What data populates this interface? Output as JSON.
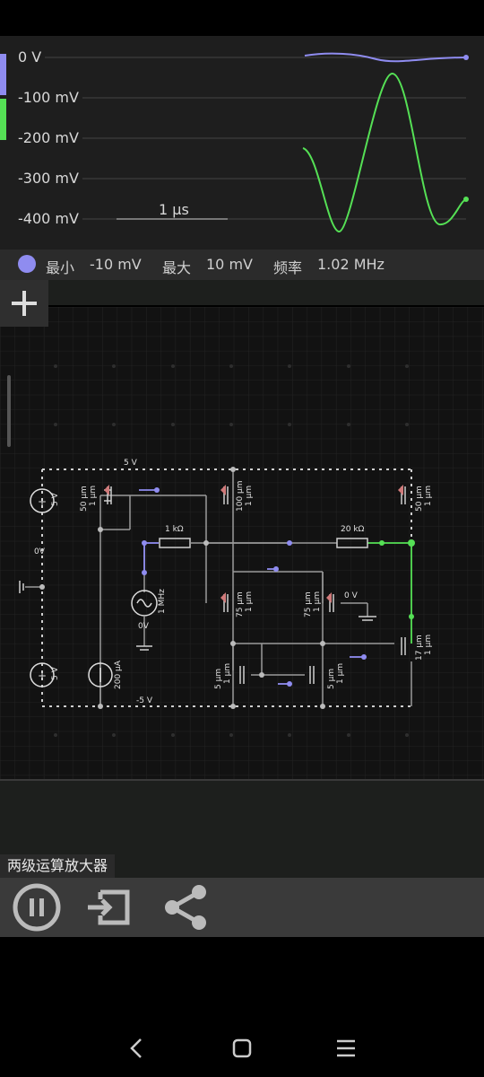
{
  "scope": {
    "y_labels": [
      "0 V",
      "-100 mV",
      "-200 mV",
      "-300 mV",
      "-400 mV"
    ],
    "time_scale": "1 μs",
    "colors": {
      "trace_voltage": "#8f8cf0",
      "trace_current": "#55e055",
      "grid": "#444444"
    }
  },
  "info": {
    "min_label": "最小",
    "min_value": "-10 mV",
    "max_label": "最大",
    "max_value": "10 mV",
    "freq_label": "频率",
    "freq_value": "1.02 MHz"
  },
  "add_button_label": "+",
  "circuit": {
    "labels": {
      "vdd": "5 V",
      "vdd_src": "5 V",
      "gnd_ref": "0V",
      "vss_src": "5 V",
      "isrc": "200 μA",
      "vss": "-5 V",
      "r1": "1 kΩ",
      "r2": "20 kΩ",
      "ac_src": "1 MHz",
      "ac_dc": "0V",
      "m1_w": "50 μm",
      "m1_l": "1 μm",
      "m2_w": "100 μm",
      "m2_l": "1 μm",
      "m3_w": "50 μm",
      "m3_l": "1 μm",
      "m4_w": "75 μm",
      "m4_l": "1 μm",
      "m5_w": "75 μm",
      "m5_l": "1 μm",
      "in_neg": "0 V",
      "m6_w": "17 μm",
      "m6_l": "1 μm",
      "m7_w": "5 μm",
      "m7_l": "1 μm",
      "m8_w": "5 μm",
      "m8_l": "1 μm"
    }
  },
  "circuit_title": "两级运算放大器",
  "toolbar": {
    "pause": "pause-icon",
    "export": "export-icon",
    "share": "share-icon"
  },
  "navbar": {
    "back": "back-icon",
    "home": "home-icon",
    "menu": "menu-icon"
  }
}
